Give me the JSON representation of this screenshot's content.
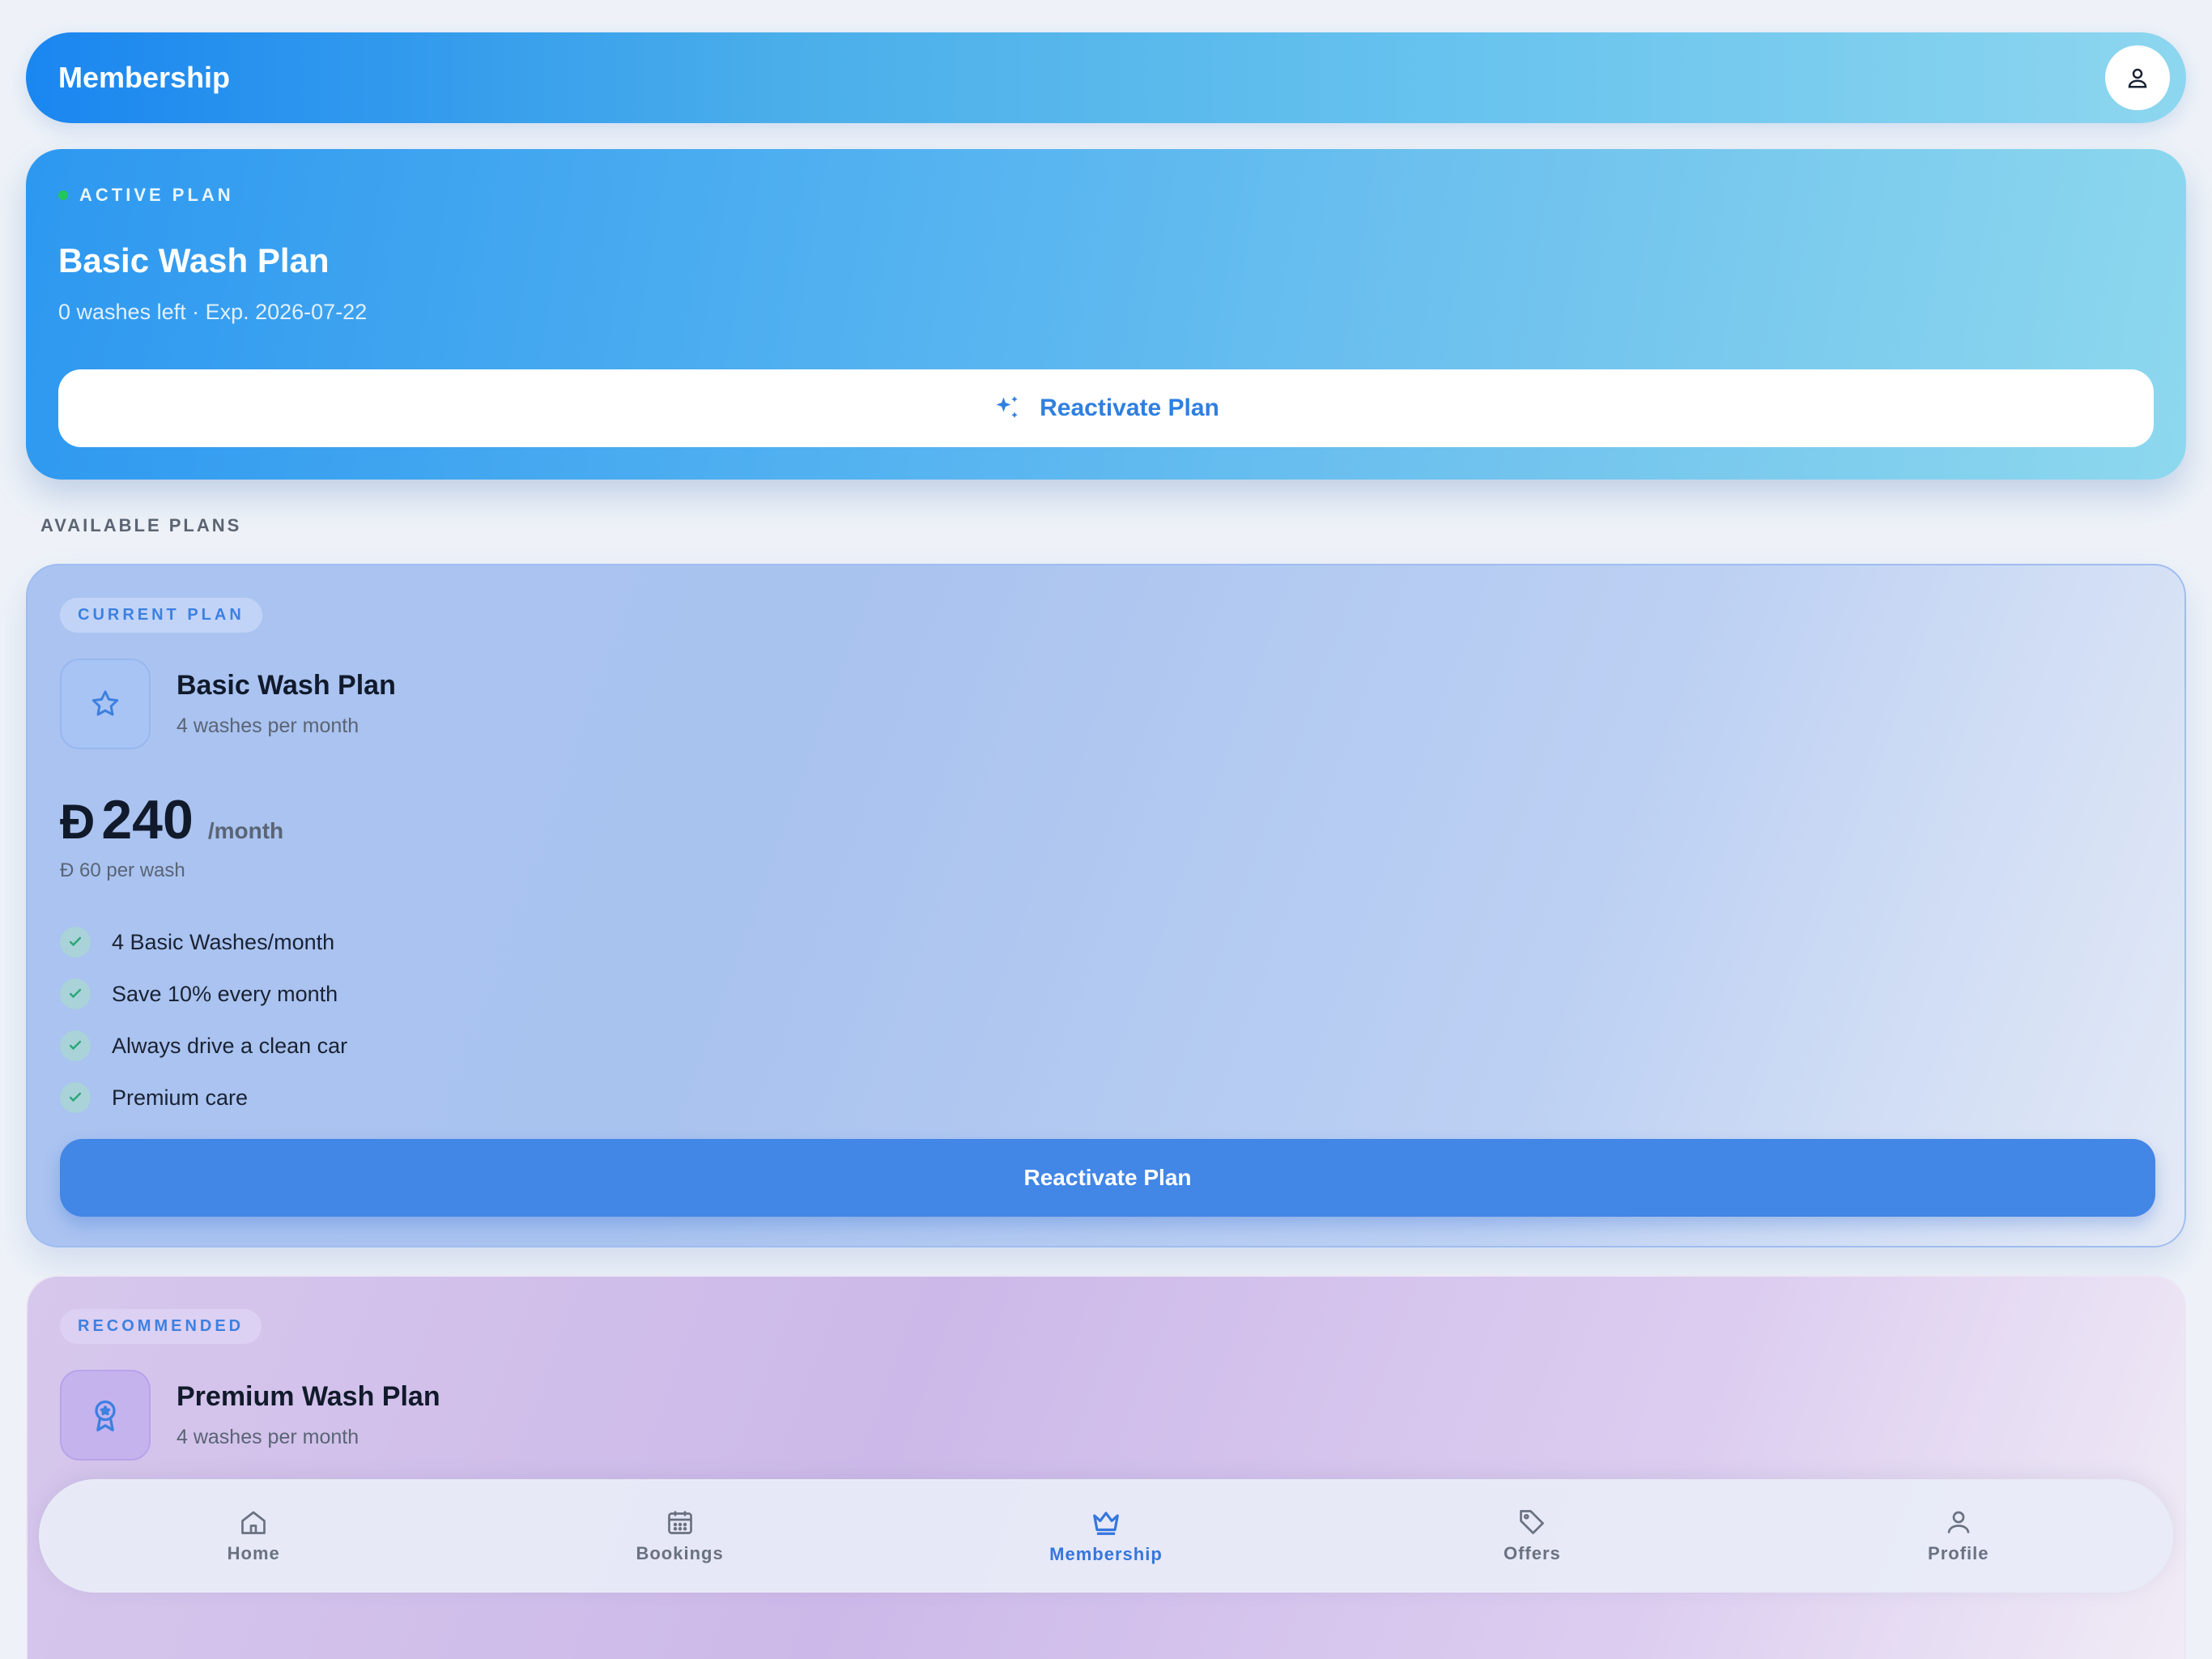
{
  "header": {
    "title": "Membership",
    "profile_icon": "user-icon"
  },
  "active_plan": {
    "label": "ACTIVE PLAN",
    "status_color": "#22c55e",
    "title": "Basic Wash Plan",
    "subtitle": "0 washes left · Exp. 2026-07-22",
    "button_label": "Reactivate Plan",
    "button_icon": "sparkles-icon"
  },
  "section": {
    "title": "AVAILABLE PLANS"
  },
  "plans": [
    {
      "badge": "CURRENT PLAN",
      "icon": "star-icon",
      "name": "Basic Wash Plan",
      "subtitle": "4 washes per month",
      "currency": "Đ",
      "price": "240",
      "period": "/month",
      "per_wash": "Đ 60 per wash",
      "features": [
        "4 Basic Washes/month",
        "Save 10% every month",
        "Always drive a clean car",
        "Premium care"
      ],
      "button_label": "Reactivate Plan"
    },
    {
      "badge": "RECOMMENDED",
      "icon": "award-icon",
      "name": "Premium Wash Plan",
      "subtitle": "4 washes per month"
    }
  ],
  "nav": {
    "items": [
      {
        "label": "Home",
        "icon": "home-icon"
      },
      {
        "label": "Bookings",
        "icon": "calendar-icon"
      },
      {
        "label": "Membership",
        "icon": "crown-icon",
        "active": true
      },
      {
        "label": "Offers",
        "icon": "tag-icon"
      },
      {
        "label": "Profile",
        "icon": "user-icon"
      }
    ]
  },
  "colors": {
    "accent": "#4286e6",
    "active_nav": "#3576dc"
  }
}
